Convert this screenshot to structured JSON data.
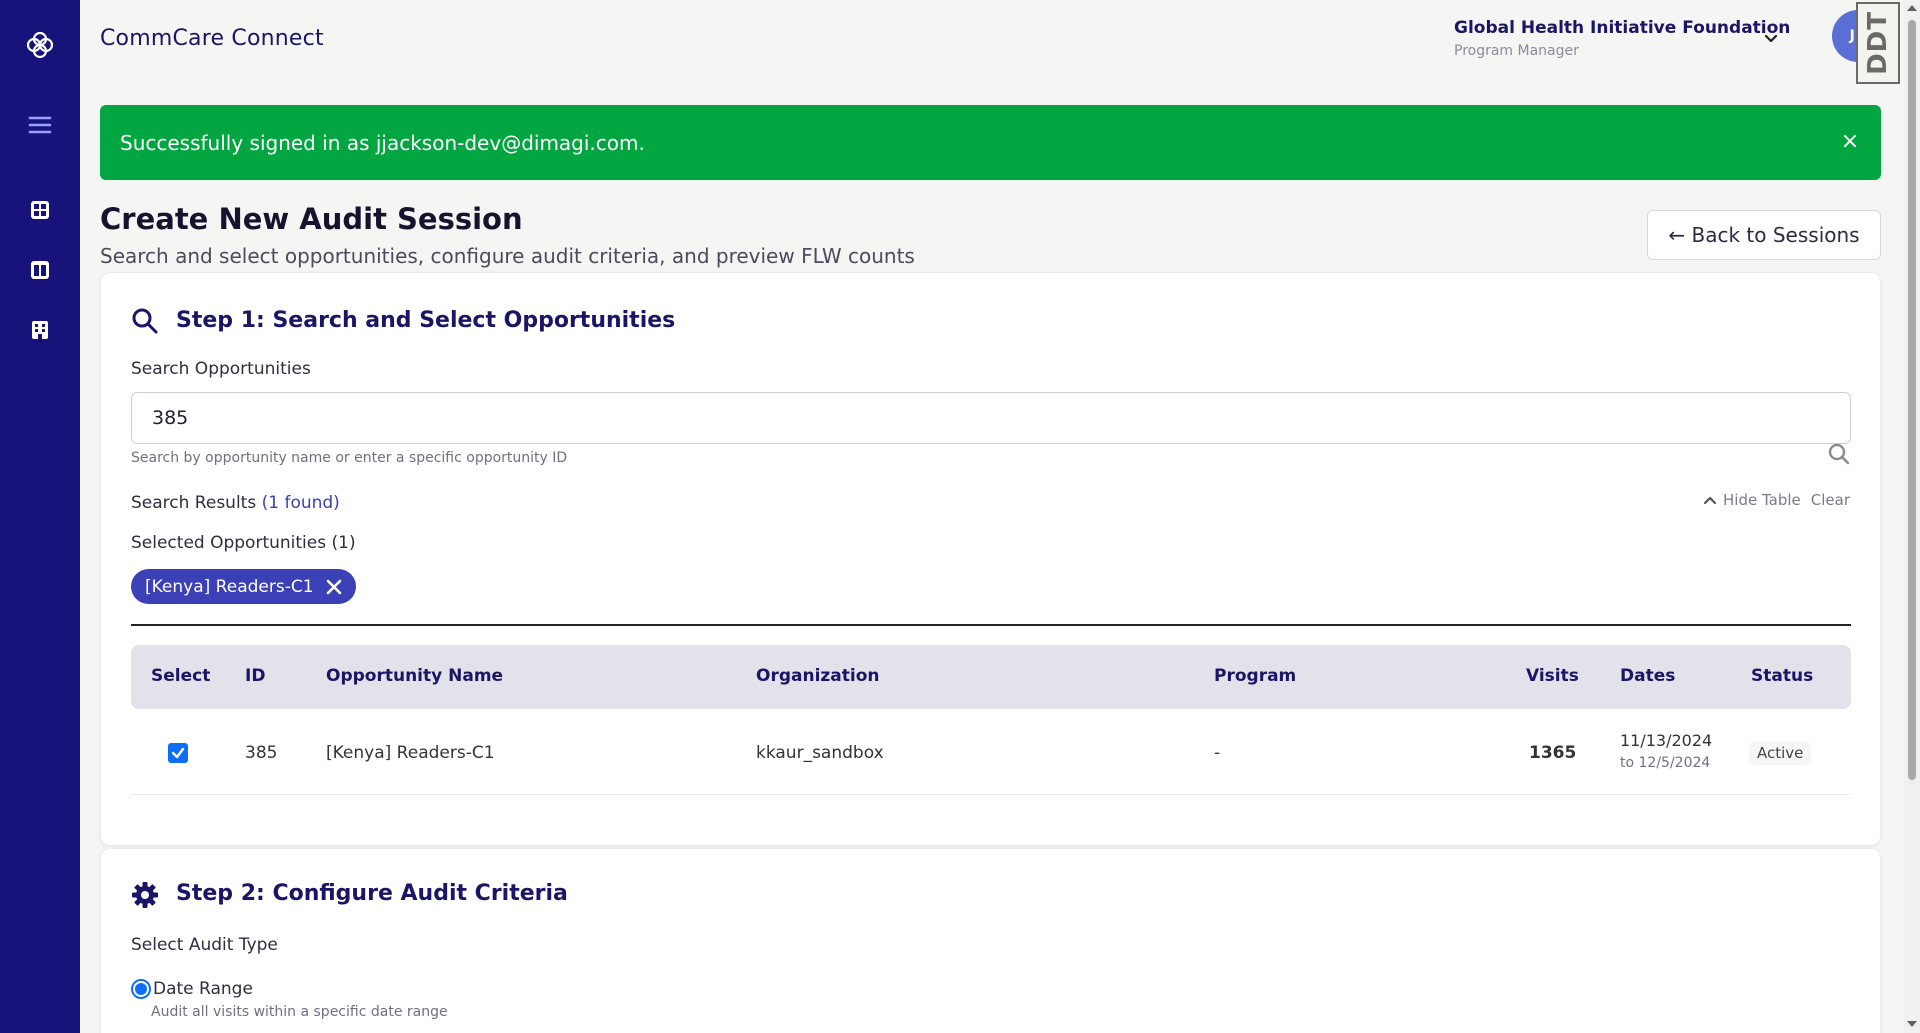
{
  "app": {
    "brand": "CommCare Connect"
  },
  "header": {
    "org_name": "Global Health Initiative Foundation",
    "org_role": "Program Manager",
    "avatar_initials": "JD",
    "badge": "DDT"
  },
  "sidebar": {
    "items": [
      {
        "icon": "logo-icon"
      },
      {
        "icon": "menu-icon"
      },
      {
        "icon": "dashboard-grid-icon"
      },
      {
        "icon": "columns-icon"
      },
      {
        "icon": "building-icon"
      }
    ]
  },
  "alert": {
    "message": "Successfully signed in as jjackson-dev@dimagi.com.",
    "close": "×",
    "color": "#02a641"
  },
  "page": {
    "title": "Create New Audit Session",
    "subtitle": "Search and select opportunities, configure audit criteria, and preview FLW counts",
    "back_button": "← Back to Sessions"
  },
  "step1": {
    "title": "Step 1: Search and Select Opportunities",
    "search_label": "Search Opportunities",
    "search_value": "385",
    "search_hint": "Search by opportunity name or enter a specific opportunity ID",
    "results_label": "Search Results",
    "results_count": "(1 found)",
    "hide_table": "Hide Table",
    "clear": "Clear",
    "selected_label": "Selected Opportunities (1)",
    "chip_label": "[Kenya] Readers-C1",
    "table": {
      "headers": [
        "Select",
        "ID",
        "Opportunity Name",
        "Organization",
        "Program",
        "Visits",
        "Dates",
        "Status"
      ],
      "rows": [
        {
          "selected": true,
          "id": "385",
          "name": "[Kenya] Readers-C1",
          "organization": "kkaur_sandbox",
          "program": "-",
          "visits": "1365",
          "date_start": "11/13/2024",
          "date_end": "to 12/5/2024",
          "status": "Active"
        }
      ]
    }
  },
  "step2": {
    "title": "Step 2: Configure Audit Criteria",
    "audit_type_label": "Select Audit Type",
    "option_label": "Date Range",
    "option_desc": "Audit all visits within a specific date range"
  },
  "colors": {
    "sidebar": "#18137a",
    "accent": "#3b40b6",
    "heading": "#1a1566",
    "checkbox": "#0d6efd"
  }
}
